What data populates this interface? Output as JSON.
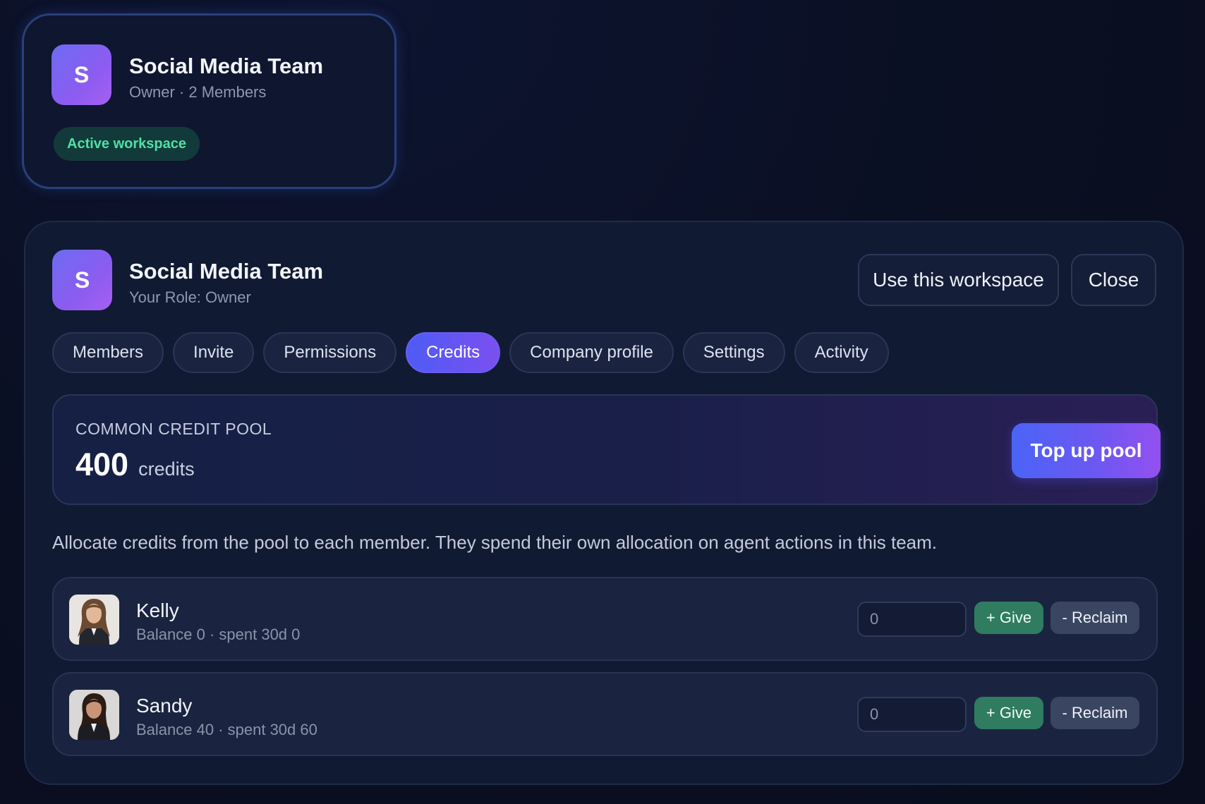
{
  "workspace_card": {
    "avatar_letter": "S",
    "title": "Social Media Team",
    "subtitle": "Owner · 2 Members",
    "badge": "Active workspace"
  },
  "panel": {
    "avatar_letter": "S",
    "title": "Social Media Team",
    "subtitle": "Your Role: Owner",
    "use_button": "Use this workspace",
    "close_button": "Close",
    "tabs": [
      {
        "label": "Members"
      },
      {
        "label": "Invite"
      },
      {
        "label": "Permissions"
      },
      {
        "label": "Credits",
        "active": true
      },
      {
        "label": "Company profile"
      },
      {
        "label": "Settings"
      },
      {
        "label": "Activity"
      }
    ],
    "pool": {
      "label": "COMMON CREDIT POOL",
      "value": "400",
      "unit": "credits",
      "topup_button": "Top up pool"
    },
    "description": "Allocate credits from the pool to each member. They spend their own allocation on agent actions in this team.",
    "members": [
      {
        "name": "Kelly",
        "meta": "Balance 0 · spent 30d 0",
        "amount": "0",
        "give_label": "+ Give",
        "reclaim_label": "- Reclaim"
      },
      {
        "name": "Sandy",
        "meta": "Balance 40 · spent 30d 60",
        "amount": "0",
        "give_label": "+ Give",
        "reclaim_label": "- Reclaim"
      }
    ]
  },
  "colors": {
    "background": "#0a0f22",
    "accent_purple": "#7b4ff0",
    "accent_blue": "#4d5cf5",
    "active_badge_text": "#4fe0a3",
    "give_green": "#2f7c61"
  },
  "icons": {
    "workspace_avatar": "letter-avatar",
    "member_avatar": "user-photo"
  }
}
